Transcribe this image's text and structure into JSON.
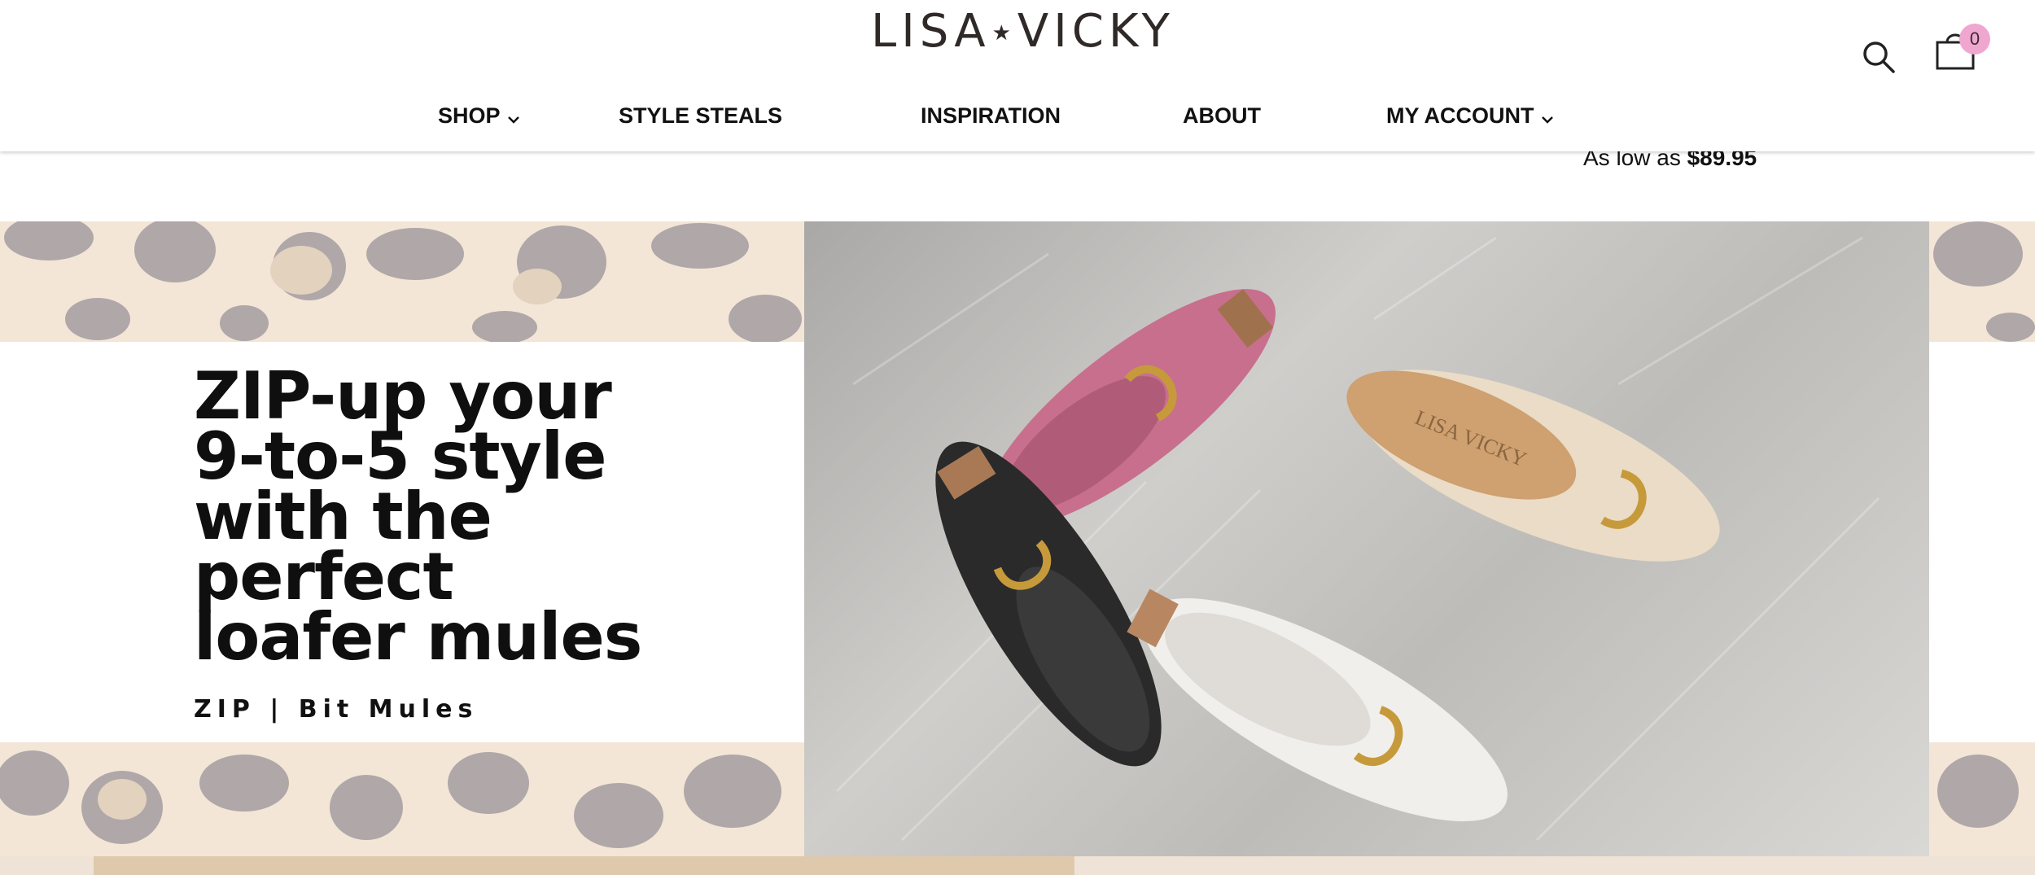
{
  "brand": {
    "logo_left": "LISA",
    "logo_star": "★",
    "logo_right": "VICKY"
  },
  "header": {
    "search_icon": "search-icon",
    "cart_icon": "shopping-bag-icon",
    "cart_count": "0"
  },
  "nav": {
    "items": [
      {
        "label": "SHOP",
        "has_dropdown": true
      },
      {
        "label": "STYLE STEALS",
        "has_dropdown": false
      },
      {
        "label": "INSPIRATION",
        "has_dropdown": false
      },
      {
        "label": "ABOUT",
        "has_dropdown": false
      },
      {
        "label": "MY ACCOUNT",
        "has_dropdown": true
      }
    ]
  },
  "price": {
    "prefix": "As low as",
    "amount": "$89.95"
  },
  "hero": {
    "headline": [
      "ZIP-up your",
      "9-to-5 style",
      "with the",
      "perfect",
      "loafer mules"
    ],
    "subline": "ZIP | Bit Mules",
    "photo_logo_text": "LISA VICKY"
  },
  "colors": {
    "cart_badge": "#f0a7cf",
    "leopard_background": "#f3e6d7",
    "leopard_spot": "#b0a7a8",
    "text": "#111111"
  }
}
